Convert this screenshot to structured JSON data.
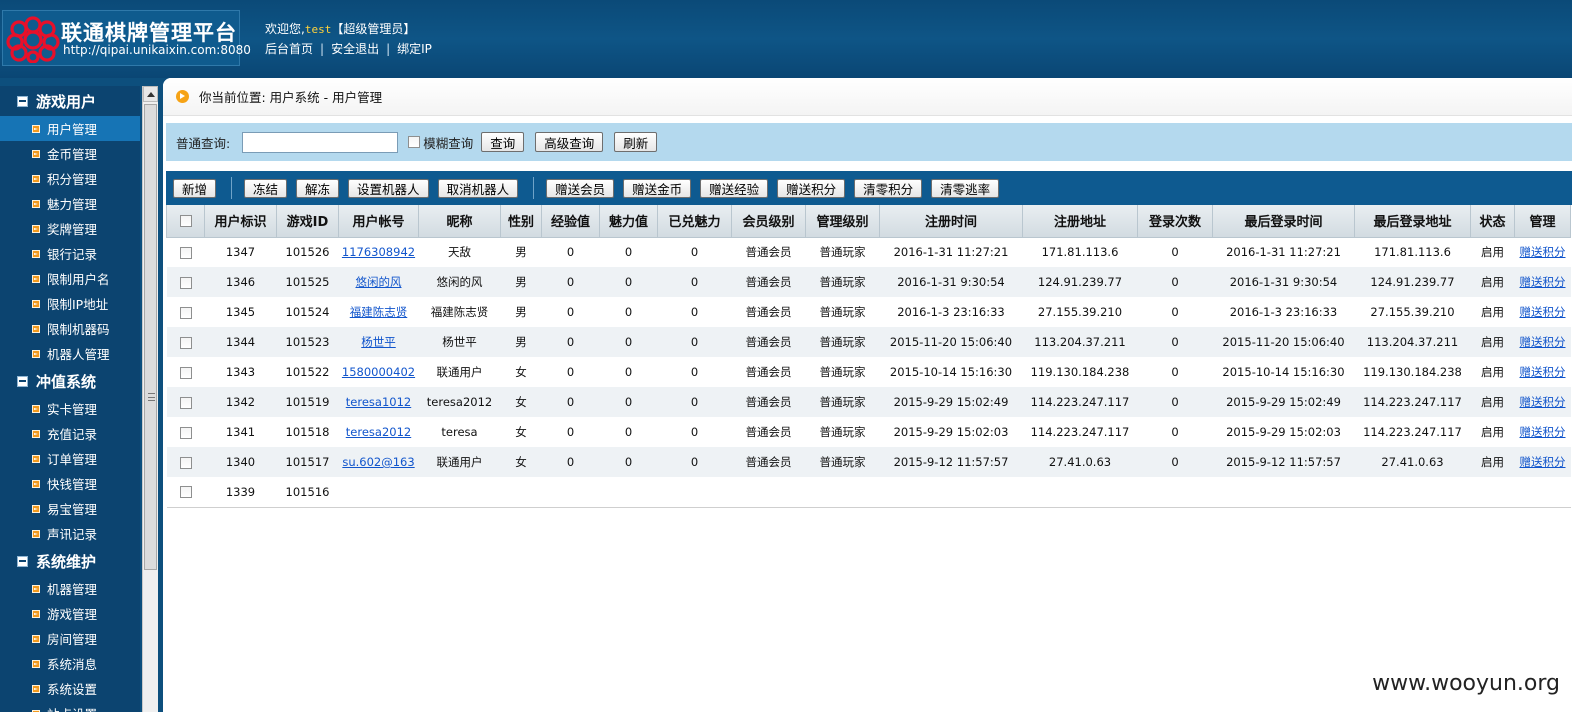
{
  "header": {
    "logo_title": "联通棋牌管理平台",
    "logo_url": "http://qipai.unikaixin.com:8080",
    "welcome_prefix": "欢迎您,",
    "username": "test",
    "role": "【超级管理员】",
    "links": [
      "后台首页",
      "安全退出",
      "绑定IP"
    ],
    "link_separator": "|"
  },
  "sidebar": {
    "groups": [
      {
        "title": "游戏用户",
        "items": [
          "用户管理",
          "金币管理",
          "积分管理",
          "魅力管理",
          "奖牌管理",
          "银行记录",
          "限制用户名",
          "限制IP地址",
          "限制机器码",
          "机器人管理"
        ]
      },
      {
        "title": "冲值系统",
        "items": [
          "实卡管理",
          "充值记录",
          "订单管理",
          "快钱管理",
          "易宝管理",
          "声讯记录"
        ]
      },
      {
        "title": "系统维护",
        "items": [
          "机器管理",
          "游戏管理",
          "房间管理",
          "系统消息",
          "系统设置",
          "站点设置"
        ]
      }
    ],
    "active_item": "用户管理"
  },
  "breadcrumb": "你当前位置: 用户系统 - 用户管理",
  "search": {
    "label": "普通查询:",
    "value": "",
    "fuzzy_label": "模糊查询",
    "query_btn": "查询",
    "advanced_btn": "高级查询",
    "refresh_btn": "刷新"
  },
  "toolbar": {
    "group1": [
      "新增"
    ],
    "group2": [
      "冻结",
      "解冻",
      "设置机器人",
      "取消机器人"
    ],
    "group3": [
      "赠送会员",
      "赠送金币",
      "赠送经验",
      "赠送积分",
      "清零积分",
      "清零逃率"
    ]
  },
  "table": {
    "columns": [
      "用户标识",
      "游戏ID",
      "用户帐号",
      "昵称",
      "性别",
      "经验值",
      "魅力值",
      "已兑魅力",
      "会员级别",
      "管理级别",
      "注册时间",
      "注册地址",
      "登录次数",
      "最后登录时间",
      "最后登录地址",
      "状态",
      "管理"
    ],
    "rows": [
      [
        "1347",
        "101526",
        "1176308942",
        "天敌",
        "男",
        "0",
        "0",
        "0",
        "普通会员",
        "普通玩家",
        "2016-1-31 11:27:21",
        "171.81.113.6",
        "0",
        "2016-1-31 11:27:21",
        "171.81.113.6",
        "启用",
        "赠送积分"
      ],
      [
        "1346",
        "101525",
        "悠闲的风",
        "悠闲的风",
        "男",
        "0",
        "0",
        "0",
        "普通会员",
        "普通玩家",
        "2016-1-31 9:30:54",
        "124.91.239.77",
        "0",
        "2016-1-31 9:30:54",
        "124.91.239.77",
        "启用",
        "赠送积分"
      ],
      [
        "1345",
        "101524",
        "福建陈志贤",
        "福建陈志贤",
        "男",
        "0",
        "0",
        "0",
        "普通会员",
        "普通玩家",
        "2016-1-3 23:16:33",
        "27.155.39.210",
        "0",
        "2016-1-3 23:16:33",
        "27.155.39.210",
        "启用",
        "赠送积分"
      ],
      [
        "1344",
        "101523",
        "杨世平",
        "杨世平",
        "男",
        "0",
        "0",
        "0",
        "普通会员",
        "普通玩家",
        "2015-11-20 15:06:40",
        "113.204.37.211",
        "0",
        "2015-11-20 15:06:40",
        "113.204.37.211",
        "启用",
        "赠送积分"
      ],
      [
        "1343",
        "101522",
        "1580000402",
        "联通用户",
        "女",
        "0",
        "0",
        "0",
        "普通会员",
        "普通玩家",
        "2015-10-14 15:16:30",
        "119.130.184.238",
        "0",
        "2015-10-14 15:16:30",
        "119.130.184.238",
        "启用",
        "赠送积分"
      ],
      [
        "1342",
        "101519",
        "teresa1012",
        "teresa2012",
        "女",
        "0",
        "0",
        "0",
        "普通会员",
        "普通玩家",
        "2015-9-29 15:02:49",
        "114.223.247.117",
        "0",
        "2015-9-29 15:02:49",
        "114.223.247.117",
        "启用",
        "赠送积分"
      ],
      [
        "1341",
        "101518",
        "teresa2012",
        "teresa",
        "女",
        "0",
        "0",
        "0",
        "普通会员",
        "普通玩家",
        "2015-9-29 15:02:03",
        "114.223.247.117",
        "0",
        "2015-9-29 15:02:03",
        "114.223.247.117",
        "启用",
        "赠送积分"
      ],
      [
        "1340",
        "101517",
        "su.602@163",
        "联通用户",
        "女",
        "0",
        "0",
        "0",
        "普通会员",
        "普通玩家",
        "2015-9-12 11:57:57",
        "27.41.0.63",
        "0",
        "2015-9-12 11:57:57",
        "27.41.0.63",
        "启用",
        "赠送积分"
      ],
      [
        "1339",
        "101516",
        "",
        "",
        "",
        "",
        "",
        "",
        "",
        "",
        "",
        "",
        "",
        "",
        "",
        "",
        ""
      ]
    ]
  },
  "watermark": "www.wooyun.org",
  "colors": {
    "header_bg": "#0b4a78",
    "sidebar_bg": "#0c4470",
    "active_item": "#1674b5",
    "search_bg": "#b4d9ee",
    "toolbar_bg": "#0e5a90",
    "link": "#1155cc",
    "bullet": "#f39a1e"
  }
}
